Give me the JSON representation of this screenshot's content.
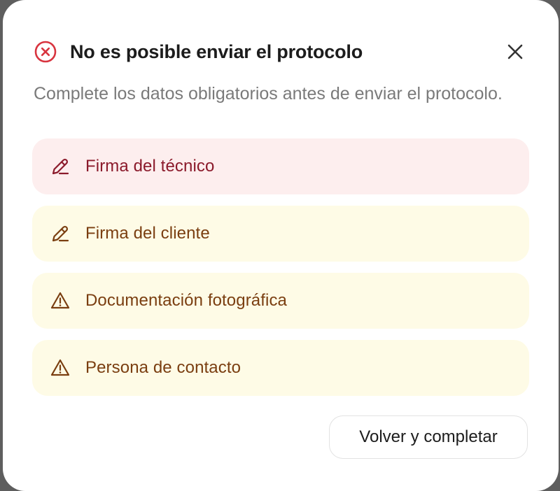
{
  "dialog": {
    "title": "No es posible enviar el protocolo",
    "description": "Complete los datos obligatorios antes de enviar el protocolo.",
    "title_icon": "error-circle-icon",
    "close_icon": "close-icon",
    "issues": [
      {
        "label": "Firma del técnico",
        "icon": "pencil-icon",
        "severity": "error"
      },
      {
        "label": "Firma del cliente",
        "icon": "pencil-icon",
        "severity": "warning"
      },
      {
        "label": "Documentación fotográfica",
        "icon": "warning-triangle-icon",
        "severity": "warning"
      },
      {
        "label": "Persona de contacto",
        "icon": "warning-triangle-icon",
        "severity": "warning"
      }
    ],
    "primary_button_label": "Volver y completar"
  },
  "colors": {
    "error_icon": "#d8343f",
    "error_bg": "#fdeeee",
    "error_text": "#8b1a2b",
    "warning_bg": "#fefbe6",
    "warning_text": "#7a3e10"
  }
}
